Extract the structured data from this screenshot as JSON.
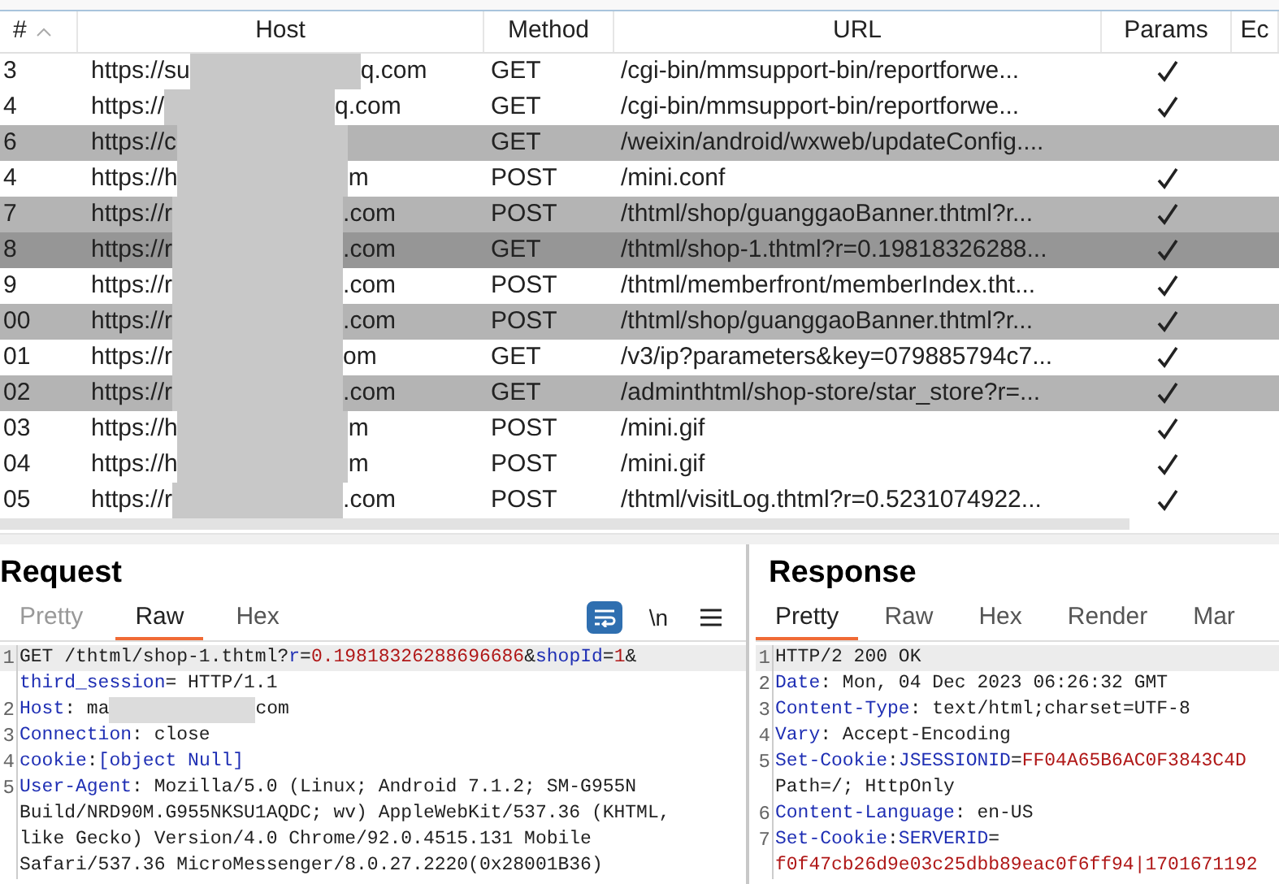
{
  "table": {
    "columns": [
      {
        "label": "#",
        "sorted_ascending": true
      },
      {
        "label": "Host"
      },
      {
        "label": "Method"
      },
      {
        "label": "URL"
      },
      {
        "label": "Params"
      },
      {
        "label": "Ec"
      }
    ],
    "rows": [
      {
        "number": "3",
        "host_start": "https://su",
        "host_end": "q.com",
        "method": "GET",
        "url": "/cgi-bin/mmsupport-bin/reportforwe...",
        "params": true,
        "highlighted": false,
        "selected": false
      },
      {
        "number": "4",
        "host_start": "https://",
        "host_end": "q.com",
        "method": "GET",
        "url": "/cgi-bin/mmsupport-bin/reportforwe...",
        "params": true,
        "highlighted": false,
        "selected": false
      },
      {
        "number": "6",
        "host_start": "https://c",
        "host_end": "",
        "method": "GET",
        "url": "/weixin/android/wxweb/updateConfig....",
        "params": false,
        "highlighted": true,
        "selected": false
      },
      {
        "number": "4",
        "host_start": "https://h",
        "host_end": "m",
        "method": "POST",
        "url": "/mini.conf",
        "params": true,
        "highlighted": false,
        "selected": false
      },
      {
        "number": "7",
        "host_start": "https://r",
        "host_end": ".com",
        "method": "POST",
        "url": "/thtml/shop/guanggaoBanner.thtml?r...",
        "params": true,
        "highlighted": true,
        "selected": false
      },
      {
        "number": "8",
        "host_start": "https://r",
        "host_end": ".com",
        "method": "GET",
        "url": "/thtml/shop-1.thtml?r=0.19818326288...",
        "params": true,
        "selected": true
      },
      {
        "number": "9",
        "host_start": "https://r",
        "host_end": ".com",
        "method": "POST",
        "url": "/thtml/memberfront/memberIndex.tht...",
        "params": true,
        "highlighted": false,
        "selected": false
      },
      {
        "number": "00",
        "host_start": "https://r",
        "host_end": ".com",
        "method": "POST",
        "url": "/thtml/shop/guanggaoBanner.thtml?r...",
        "params": true,
        "highlighted": true,
        "selected": false
      },
      {
        "number": "01",
        "host_start": "https://r",
        "host_end": "om",
        "method": "GET",
        "url": "/v3/ip?parameters&key=079885794c7...",
        "params": true,
        "highlighted": false,
        "selected": false
      },
      {
        "number": "02",
        "host_start": "https://r",
        "host_end": ".com",
        "method": "GET",
        "url": "/adminthtml/shop-store/star_store?r=...",
        "params": true,
        "highlighted": true,
        "selected": false
      },
      {
        "number": "03",
        "host_start": "https://h",
        "host_end": "m",
        "method": "POST",
        "url": "/mini.gif",
        "params": true,
        "highlighted": false,
        "selected": false
      },
      {
        "number": "04",
        "host_start": "https://h",
        "host_end": "m",
        "method": "POST",
        "url": "/mini.gif",
        "params": true,
        "highlighted": false,
        "selected": false
      },
      {
        "number": "05",
        "host_start": "https://r",
        "host_end": ".com",
        "method": "POST",
        "url": "/thtml/visitLog.thtml?r=0.5231074922...",
        "params": true,
        "highlighted": false,
        "selected": false
      }
    ]
  },
  "request": {
    "title": "Request",
    "tabs": [
      {
        "label": "Pretty",
        "selected": false
      },
      {
        "label": "Raw",
        "selected": true
      },
      {
        "label": "Hex",
        "selected": false
      }
    ],
    "tools": [
      {
        "kind": "wrap",
        "active": true
      },
      {
        "kind": "text",
        "label": "\\n",
        "active": false
      },
      {
        "kind": "menu",
        "active": false
      }
    ],
    "lines": [
      {
        "number": "1",
        "current": true,
        "segments": [
          {
            "kind": "plain",
            "text": "GET /thtml/shop-1.thtml?"
          },
          {
            "kind": "key",
            "text": "r"
          },
          {
            "kind": "plain",
            "text": "="
          },
          {
            "kind": "value",
            "text": "0.19818326288696686"
          },
          {
            "kind": "plain",
            "text": "&"
          },
          {
            "kind": "key",
            "text": "shopId"
          },
          {
            "kind": "plain",
            "text": "="
          },
          {
            "kind": "value",
            "text": "1"
          },
          {
            "kind": "plain",
            "text": "&"
          }
        ]
      },
      {
        "current": false,
        "segments": [
          {
            "kind": "key",
            "text": "third_session"
          },
          {
            "kind": "plain",
            "text": "= HTTP/1.1"
          }
        ]
      },
      {
        "number": "2",
        "current": false,
        "segments": [
          {
            "kind": "key",
            "text": "Host"
          },
          {
            "kind": "plain",
            "text": ": ma"
          },
          {
            "kind": "redacted"
          },
          {
            "kind": "plain",
            "text": "com"
          }
        ]
      },
      {
        "number": "3",
        "current": false,
        "segments": [
          {
            "kind": "key",
            "text": "Connection"
          },
          {
            "kind": "plain",
            "text": ": close"
          }
        ]
      },
      {
        "number": "4",
        "current": false,
        "segments": [
          {
            "kind": "key",
            "text": "cookie"
          },
          {
            "kind": "plain",
            "text": ": "
          },
          {
            "kind": "key",
            "text": "[object Null]"
          }
        ]
      },
      {
        "number": "5",
        "current": false,
        "segments": [
          {
            "kind": "key",
            "text": "User-Agent"
          },
          {
            "kind": "plain",
            "text": ": Mozilla/5.0 (Linux; Android 7.1.2; SM-G955N"
          }
        ]
      },
      {
        "current": false,
        "segments": [
          {
            "kind": "plain",
            "text": "Build/NRD90M.G955NKSU1AQDC; wv) AppleWebKit/537.36 (KHTML,"
          }
        ]
      },
      {
        "current": false,
        "segments": [
          {
            "kind": "plain",
            "text": "like Gecko) Version/4.0 Chrome/92.0.4515.131 Mobile"
          }
        ]
      },
      {
        "current": false,
        "segments": [
          {
            "kind": "plain",
            "text": "Safari/537.36 MicroMessenger/8.0.27.2220(0x28001B36)"
          }
        ]
      }
    ]
  },
  "response": {
    "title": "Response",
    "tabs": [
      {
        "label": "Pretty",
        "selected": true
      },
      {
        "label": "Raw",
        "selected": false
      },
      {
        "label": "Hex",
        "selected": false
      },
      {
        "label": "Render",
        "selected": false
      },
      {
        "label": "Mar",
        "selected": false
      }
    ],
    "lines": [
      {
        "number": "1",
        "current": true,
        "segments": [
          {
            "kind": "plain",
            "text": "HTTP/2 200 OK"
          }
        ]
      },
      {
        "number": "2",
        "current": false,
        "segments": [
          {
            "kind": "key",
            "text": "Date"
          },
          {
            "kind": "plain",
            "text": ": Mon, 04 Dec 2023 06:26:32 GMT"
          }
        ]
      },
      {
        "number": "3",
        "current": false,
        "segments": [
          {
            "kind": "key",
            "text": "Content-Type"
          },
          {
            "kind": "plain",
            "text": ": text/html;charset=UTF-8"
          }
        ]
      },
      {
        "number": "4",
        "current": false,
        "segments": [
          {
            "kind": "key",
            "text": "Vary"
          },
          {
            "kind": "plain",
            "text": ": Accept-Encoding"
          }
        ]
      },
      {
        "number": "5",
        "current": false,
        "segments": [
          {
            "kind": "key",
            "text": "Set-Cookie"
          },
          {
            "kind": "plain",
            "text": ": "
          },
          {
            "kind": "key",
            "text": "JSESSIONID"
          },
          {
            "kind": "plain",
            "text": "="
          },
          {
            "kind": "value",
            "text": "FF04A65B6AC0F3843C4D"
          }
        ]
      },
      {
        "current": false,
        "segments": [
          {
            "kind": "plain",
            "text": "Path=/; HttpOnly"
          }
        ]
      },
      {
        "number": "6",
        "current": false,
        "segments": [
          {
            "kind": "key",
            "text": "Content-Language"
          },
          {
            "kind": "plain",
            "text": ": en-US"
          }
        ]
      },
      {
        "number": "7",
        "current": false,
        "segments": [
          {
            "kind": "key",
            "text": "Set-Cookie"
          },
          {
            "kind": "plain",
            "text": ": "
          },
          {
            "kind": "key",
            "text": "SERVERID"
          },
          {
            "kind": "plain",
            "text": "="
          }
        ]
      },
      {
        "current": false,
        "segments": [
          {
            "kind": "value",
            "text": "f0f47cb26d9e03c25dbb89eac0f6ff94|1701671192"
          }
        ]
      }
    ]
  }
}
